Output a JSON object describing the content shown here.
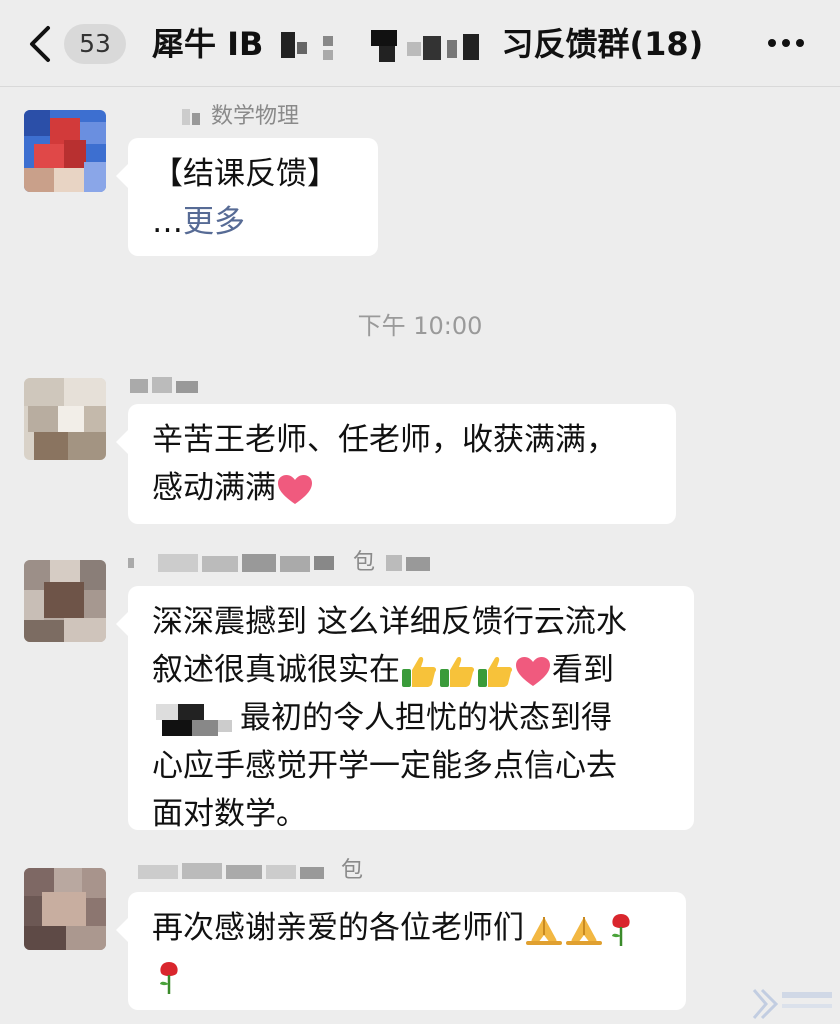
{
  "header": {
    "unread_count": "53",
    "title_start": "犀牛 IB",
    "title_end": "习反馈群(18)"
  },
  "messages": [
    {
      "sender": "数学物理",
      "lines": [
        "【结课反馈】"
      ],
      "more_prefix": "…",
      "more_label": "更多"
    },
    {
      "sender": "",
      "lines": [
        "辛苦王老师、任老师，收获满满，",
        "感动满满"
      ]
    },
    {
      "sender": "包",
      "lines": [
        "深深震撼到 这么详细反馈行云流水",
        "叙述很真诚很实在",
        "看到",
        "最初的令人担忧的状态到得",
        "心应手感觉开学一定能多点信心去",
        "面对数学。"
      ]
    },
    {
      "sender": "包",
      "lines": [
        "再次感谢亲爱的各位老师们"
      ]
    }
  ],
  "timestamp": "下午 10:00",
  "icons": {
    "back": "chevron-left-icon",
    "more": "ellipsis-icon",
    "heart": "heart-emoji",
    "thumbs": "thumbs-up-emoji",
    "pray": "folded-hands-emoji",
    "rose": "rose-emoji"
  },
  "colors": {
    "background": "#ededed",
    "bubble": "#ffffff",
    "link": "#576b95",
    "heart": "#f05a7e"
  }
}
